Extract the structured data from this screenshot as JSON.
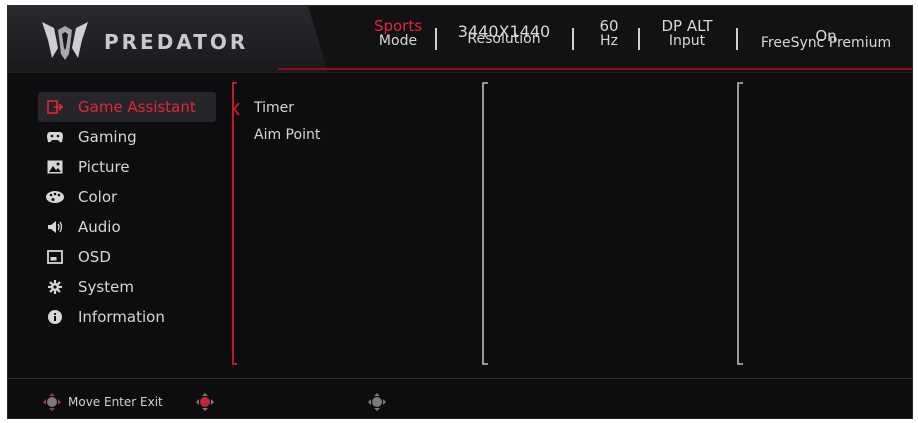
{
  "brand": {
    "name": "PREDATOR"
  },
  "status": {
    "mode": {
      "value": "Sports",
      "label": "Mode"
    },
    "resolution": {
      "value": "3440X1440",
      "label": "Resolution"
    },
    "refresh": {
      "value": "60",
      "label": "Hz"
    },
    "input": {
      "value": "DP ALT",
      "label": "Input"
    },
    "freesync": {
      "value": "On",
      "label": "FreeSync Premium"
    }
  },
  "menu": {
    "items": [
      {
        "label": "Game Assistant",
        "icon": "game-assistant-icon",
        "active": true
      },
      {
        "label": "Gaming",
        "icon": "gamepad-icon"
      },
      {
        "label": "Picture",
        "icon": "picture-icon"
      },
      {
        "label": "Color",
        "icon": "palette-icon"
      },
      {
        "label": "Audio",
        "icon": "speaker-icon"
      },
      {
        "label": "OSD",
        "icon": "osd-icon"
      },
      {
        "label": "System",
        "icon": "gear-icon"
      },
      {
        "label": "Information",
        "icon": "info-icon"
      }
    ]
  },
  "submenu": {
    "items": [
      "Timer",
      "Aim Point"
    ]
  },
  "footer": {
    "hint": "Move Enter Exit"
  },
  "colors": {
    "accent": "#e1263a",
    "background": "#0d0d0f",
    "text": "#d6d6d6"
  }
}
